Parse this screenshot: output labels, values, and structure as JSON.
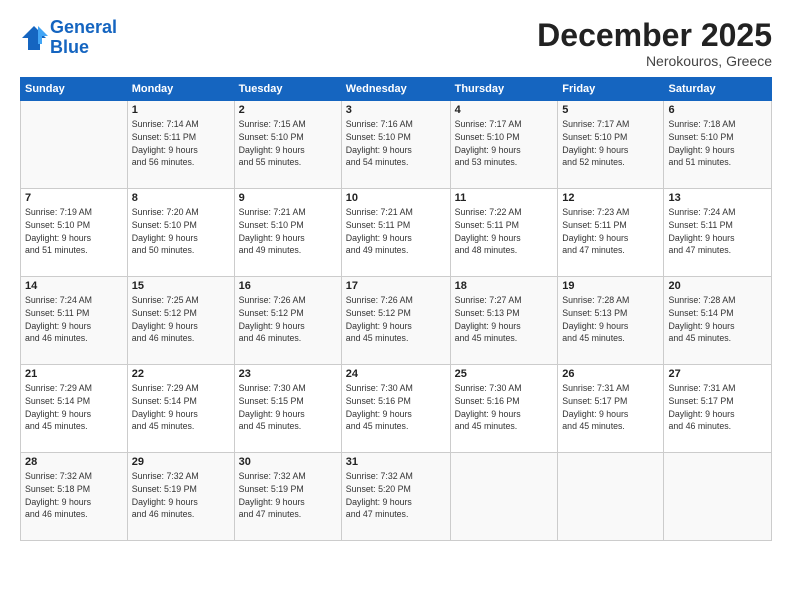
{
  "logo": {
    "line1": "General",
    "line2": "Blue"
  },
  "title": "December 2025",
  "location": "Nerokouros, Greece",
  "days_header": [
    "Sunday",
    "Monday",
    "Tuesday",
    "Wednesday",
    "Thursday",
    "Friday",
    "Saturday"
  ],
  "weeks": [
    [
      {
        "num": "",
        "info": ""
      },
      {
        "num": "1",
        "info": "Sunrise: 7:14 AM\nSunset: 5:11 PM\nDaylight: 9 hours\nand 56 minutes."
      },
      {
        "num": "2",
        "info": "Sunrise: 7:15 AM\nSunset: 5:10 PM\nDaylight: 9 hours\nand 55 minutes."
      },
      {
        "num": "3",
        "info": "Sunrise: 7:16 AM\nSunset: 5:10 PM\nDaylight: 9 hours\nand 54 minutes."
      },
      {
        "num": "4",
        "info": "Sunrise: 7:17 AM\nSunset: 5:10 PM\nDaylight: 9 hours\nand 53 minutes."
      },
      {
        "num": "5",
        "info": "Sunrise: 7:17 AM\nSunset: 5:10 PM\nDaylight: 9 hours\nand 52 minutes."
      },
      {
        "num": "6",
        "info": "Sunrise: 7:18 AM\nSunset: 5:10 PM\nDaylight: 9 hours\nand 51 minutes."
      }
    ],
    [
      {
        "num": "7",
        "info": "Sunrise: 7:19 AM\nSunset: 5:10 PM\nDaylight: 9 hours\nand 51 minutes."
      },
      {
        "num": "8",
        "info": "Sunrise: 7:20 AM\nSunset: 5:10 PM\nDaylight: 9 hours\nand 50 minutes."
      },
      {
        "num": "9",
        "info": "Sunrise: 7:21 AM\nSunset: 5:10 PM\nDaylight: 9 hours\nand 49 minutes."
      },
      {
        "num": "10",
        "info": "Sunrise: 7:21 AM\nSunset: 5:11 PM\nDaylight: 9 hours\nand 49 minutes."
      },
      {
        "num": "11",
        "info": "Sunrise: 7:22 AM\nSunset: 5:11 PM\nDaylight: 9 hours\nand 48 minutes."
      },
      {
        "num": "12",
        "info": "Sunrise: 7:23 AM\nSunset: 5:11 PM\nDaylight: 9 hours\nand 47 minutes."
      },
      {
        "num": "13",
        "info": "Sunrise: 7:24 AM\nSunset: 5:11 PM\nDaylight: 9 hours\nand 47 minutes."
      }
    ],
    [
      {
        "num": "14",
        "info": "Sunrise: 7:24 AM\nSunset: 5:11 PM\nDaylight: 9 hours\nand 46 minutes."
      },
      {
        "num": "15",
        "info": "Sunrise: 7:25 AM\nSunset: 5:12 PM\nDaylight: 9 hours\nand 46 minutes."
      },
      {
        "num": "16",
        "info": "Sunrise: 7:26 AM\nSunset: 5:12 PM\nDaylight: 9 hours\nand 46 minutes."
      },
      {
        "num": "17",
        "info": "Sunrise: 7:26 AM\nSunset: 5:12 PM\nDaylight: 9 hours\nand 45 minutes."
      },
      {
        "num": "18",
        "info": "Sunrise: 7:27 AM\nSunset: 5:13 PM\nDaylight: 9 hours\nand 45 minutes."
      },
      {
        "num": "19",
        "info": "Sunrise: 7:28 AM\nSunset: 5:13 PM\nDaylight: 9 hours\nand 45 minutes."
      },
      {
        "num": "20",
        "info": "Sunrise: 7:28 AM\nSunset: 5:14 PM\nDaylight: 9 hours\nand 45 minutes."
      }
    ],
    [
      {
        "num": "21",
        "info": "Sunrise: 7:29 AM\nSunset: 5:14 PM\nDaylight: 9 hours\nand 45 minutes."
      },
      {
        "num": "22",
        "info": "Sunrise: 7:29 AM\nSunset: 5:14 PM\nDaylight: 9 hours\nand 45 minutes."
      },
      {
        "num": "23",
        "info": "Sunrise: 7:30 AM\nSunset: 5:15 PM\nDaylight: 9 hours\nand 45 minutes."
      },
      {
        "num": "24",
        "info": "Sunrise: 7:30 AM\nSunset: 5:16 PM\nDaylight: 9 hours\nand 45 minutes."
      },
      {
        "num": "25",
        "info": "Sunrise: 7:30 AM\nSunset: 5:16 PM\nDaylight: 9 hours\nand 45 minutes."
      },
      {
        "num": "26",
        "info": "Sunrise: 7:31 AM\nSunset: 5:17 PM\nDaylight: 9 hours\nand 45 minutes."
      },
      {
        "num": "27",
        "info": "Sunrise: 7:31 AM\nSunset: 5:17 PM\nDaylight: 9 hours\nand 46 minutes."
      }
    ],
    [
      {
        "num": "28",
        "info": "Sunrise: 7:32 AM\nSunset: 5:18 PM\nDaylight: 9 hours\nand 46 minutes."
      },
      {
        "num": "29",
        "info": "Sunrise: 7:32 AM\nSunset: 5:19 PM\nDaylight: 9 hours\nand 46 minutes."
      },
      {
        "num": "30",
        "info": "Sunrise: 7:32 AM\nSunset: 5:19 PM\nDaylight: 9 hours\nand 47 minutes."
      },
      {
        "num": "31",
        "info": "Sunrise: 7:32 AM\nSunset: 5:20 PM\nDaylight: 9 hours\nand 47 minutes."
      },
      {
        "num": "",
        "info": ""
      },
      {
        "num": "",
        "info": ""
      },
      {
        "num": "",
        "info": ""
      }
    ]
  ]
}
